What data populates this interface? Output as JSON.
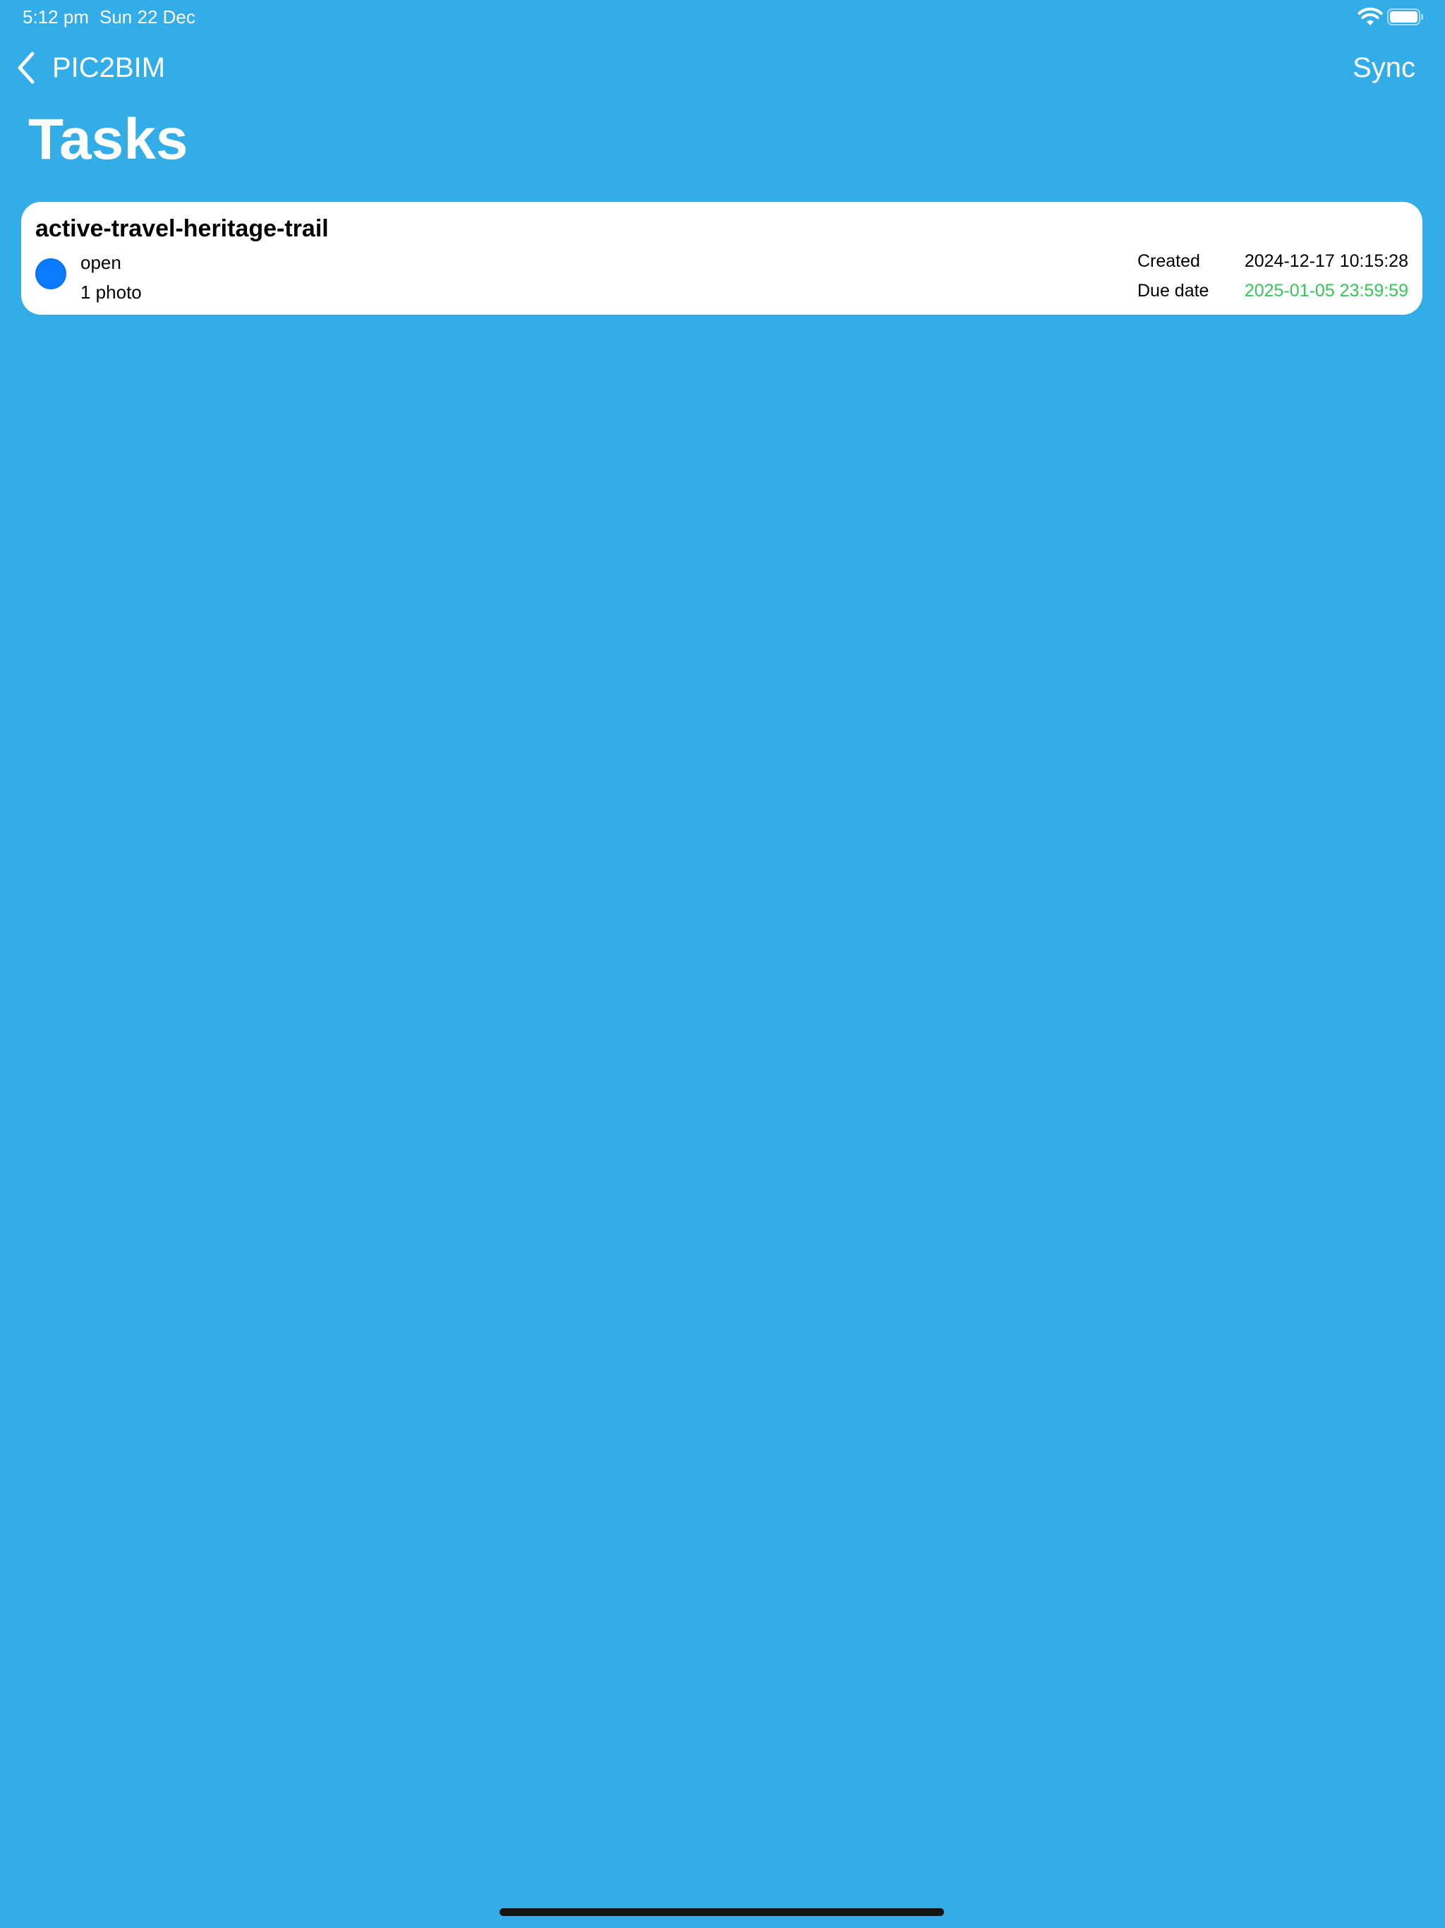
{
  "status_bar": {
    "time": "5:12 pm",
    "date": "Sun 22 Dec",
    "wifi_icon": "wifi-icon",
    "battery_icon": "battery-icon"
  },
  "nav": {
    "back_label": "PIC2BIM",
    "back_icon": "chevron-left-icon",
    "sync_label": "Sync"
  },
  "page": {
    "title": "Tasks"
  },
  "tasks": [
    {
      "name": "active-travel-heritage-trail",
      "status": "open",
      "status_color": "#0A7BFF",
      "photos": "1 photo",
      "created_label": "Created",
      "created_value": "2024-12-17 10:15:28",
      "due_label": "Due date",
      "due_value": "2025-01-05 23:59:59",
      "due_color": "#34C759"
    }
  ],
  "colors": {
    "background": "#33ADE7",
    "card": "#FFFFFF",
    "text_on_bg": "#FFFFFF"
  }
}
